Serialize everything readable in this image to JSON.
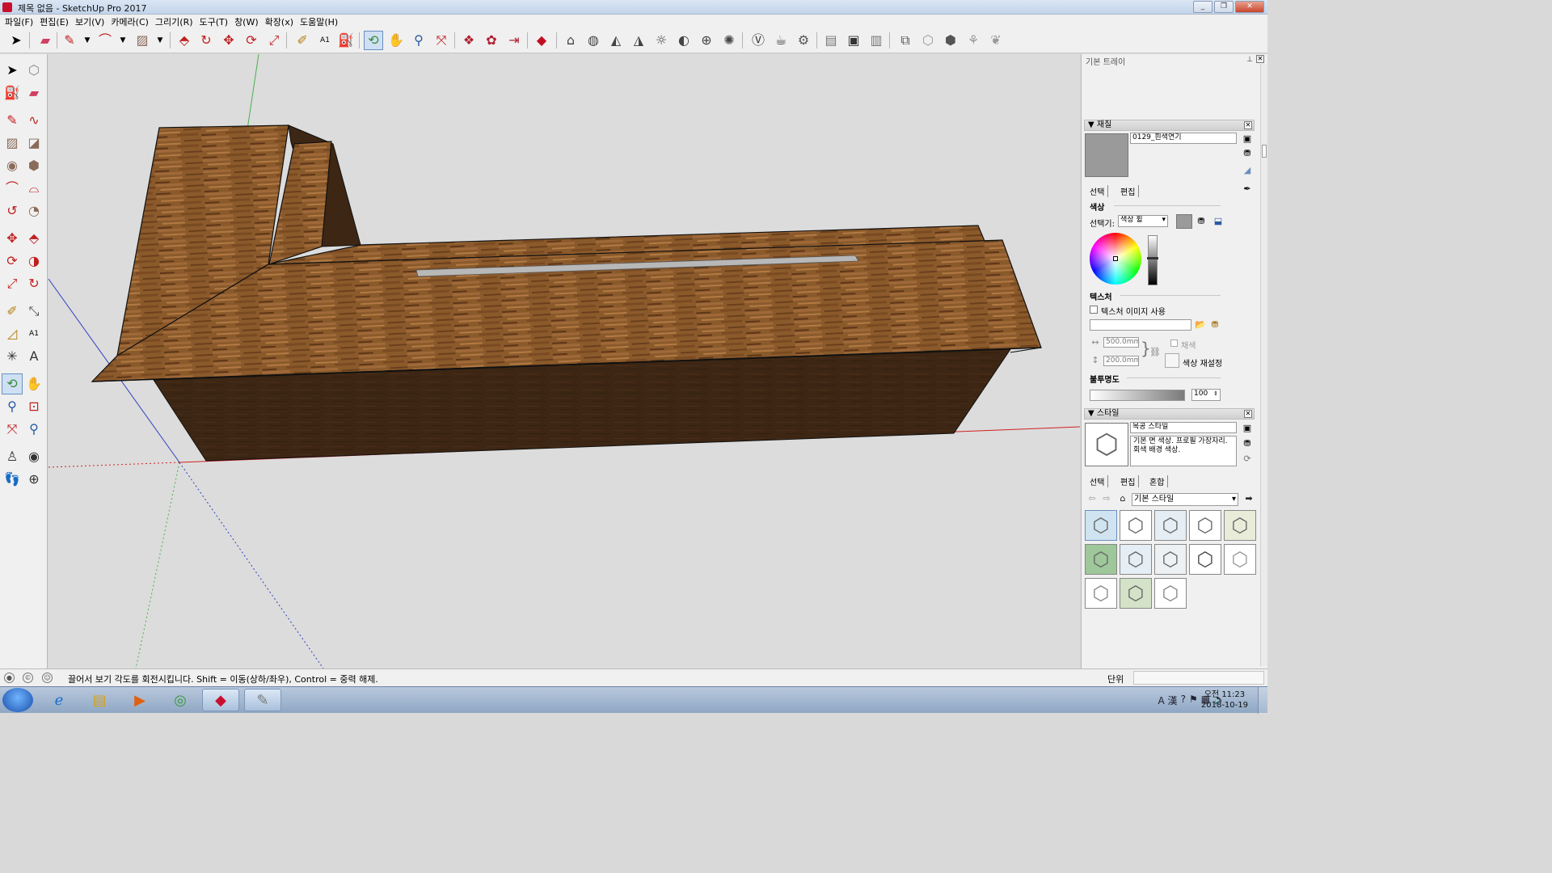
{
  "window": {
    "title": "제목 없음 - SketchUp Pro 2017",
    "minimize": "_",
    "restore": "❐",
    "close": "✕"
  },
  "menu": [
    "파일(F)",
    "편집(E)",
    "보기(V)",
    "카메라(C)",
    "그리기(R)",
    "도구(T)",
    "창(W)",
    "확장(x)",
    "도움말(H)"
  ],
  "toolbar": {
    "top_icons": [
      "select-arrow",
      "eraser",
      "pencil-line",
      "dropdown",
      "arc",
      "dropdown",
      "rectangle",
      "dropdown",
      "push-pull",
      "follow-me",
      "move",
      "rotate",
      "scale",
      "tape-measure",
      "text",
      "paint-bucket",
      "orbit",
      "pan",
      "zoom",
      "zoom-extents",
      "components-3d-warehouse",
      "extension-warehouse",
      "send-to-layout",
      "ruby-gem",
      "section-plane",
      "shaded",
      "x-ray",
      "shadows",
      "fog",
      "sun",
      "wireframe",
      "hidden-line",
      "monochrome",
      "sandbox",
      "teapot",
      "component-options",
      "front-view",
      "right-view",
      "back-view",
      "iso-view",
      "perspective",
      "walk",
      "look-around",
      "grass",
      "leaf"
    ],
    "left_icons": [
      "select",
      "component",
      "paint",
      "eraser",
      "line",
      "freehand",
      "rectangle",
      "rotated-rect",
      "circle",
      "polygon",
      "arc",
      "two-point-arc",
      "three-point-arc",
      "pie",
      "move",
      "push-pull",
      "rotate",
      "follow-me",
      "scale",
      "offset",
      "tape",
      "dimension",
      "protractor",
      "text",
      "axes",
      "3d-text",
      "orbit",
      "pan",
      "zoom",
      "zoom-window",
      "zoom-extents",
      "previous",
      "position-camera",
      "look-around",
      "walk",
      "section-plane"
    ]
  },
  "tray": {
    "title": "기본 트레이",
    "materials": {
      "header": "재질",
      "name_value": "0129_흰색연기",
      "tab_select": "선택",
      "tab_edit": "편집",
      "color_label": "색상",
      "picker_label": "선택기:",
      "picker_value": "색상 휠",
      "texture_label": "텍스처",
      "use_texture_image": "텍스처 이미지 사용",
      "width_value": "500.0mm",
      "height_value": "200.0mm",
      "colorize": "채색",
      "reset_color": "색상 재설정",
      "opacity_label": "불투명도",
      "opacity_value": "100",
      "swatch_color": "#9a9a9a"
    },
    "styles": {
      "header": "스타일",
      "name_value": "목공 스타일",
      "description": "기본 면 색상. 프로필 가장자리. 회색 배경 색상.",
      "tab_select": "선택",
      "tab_edit": "편집",
      "tab_mix": "혼합",
      "collection_value": "기본 스타일",
      "thumbnails": 13
    }
  },
  "status": {
    "message": "끌어서 보기 각도를 회전시킵니다. Shift = 이동(상하/좌우), Control = 중력 해제.",
    "measurements_label": "단위",
    "measurements_value": ""
  },
  "taskbar": {
    "clock_time": "오전 11:23",
    "clock_date": "2018-10-19",
    "ime": "A 漢"
  },
  "colors": {
    "wood_top": "#8b5a2b",
    "wood_side": "#3d2614",
    "viewport_bg": "#dcdcdc",
    "slot": "#b8b8b8"
  }
}
